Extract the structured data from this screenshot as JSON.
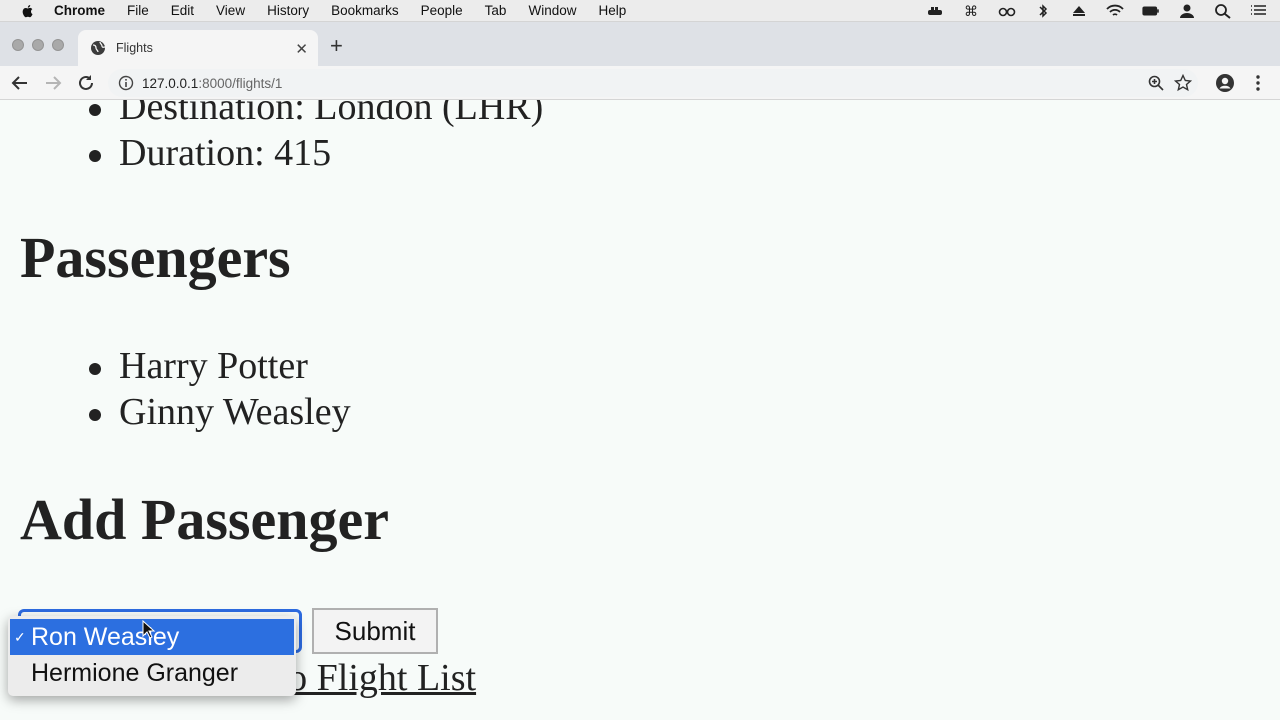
{
  "menubar": {
    "app": "Chrome",
    "items": [
      "File",
      "Edit",
      "View",
      "History",
      "Bookmarks",
      "People",
      "Tab",
      "Window",
      "Help"
    ]
  },
  "tab": {
    "title": "Flights"
  },
  "toolbar": {
    "url_host": "127.0.0.1",
    "url_path": ":8000/flights/1"
  },
  "flight_details": [
    "Destination: London (LHR)",
    "Duration: 415"
  ],
  "passengers_heading": "Passengers",
  "passengers": [
    "Harry Potter",
    "Ginny Weasley"
  ],
  "add_heading": "Add Passenger",
  "form": {
    "selected": "Ron Weasley",
    "options": [
      "Ron Weasley",
      "Hermione Granger"
    ],
    "submit_label": "Submit",
    "check_mark": "✓"
  },
  "back_link": "Back to Flight List",
  "colors": {
    "accent": "#2c6fe0",
    "page_bg": "#f7fbf9"
  }
}
